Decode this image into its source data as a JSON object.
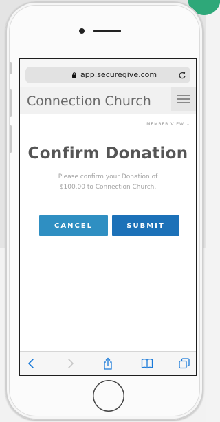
{
  "browser": {
    "url": "app.securegive.com"
  },
  "site": {
    "title": "Connection Church",
    "member_view_label": "MEMBER VIEW"
  },
  "dialog": {
    "title": "Confirm Donation",
    "message": "Please confirm your Donation of $100.00 to Connection Church.",
    "cancel_label": "CANCEL",
    "submit_label": "SUBMIT"
  },
  "colors": {
    "cancel_button": "#2f8fc2",
    "submit_button": "#1c71b8",
    "toolbar_icon": "#1a7ad9",
    "corner_accent": "#2ea879"
  },
  "icons": {
    "lock": "lock-icon",
    "reload": "reload-icon",
    "menu": "hamburger-icon",
    "back": "back-arrow-icon",
    "forward": "forward-arrow-icon",
    "share": "share-icon",
    "bookmarks": "bookmarks-icon",
    "tabs": "tabs-icon"
  }
}
